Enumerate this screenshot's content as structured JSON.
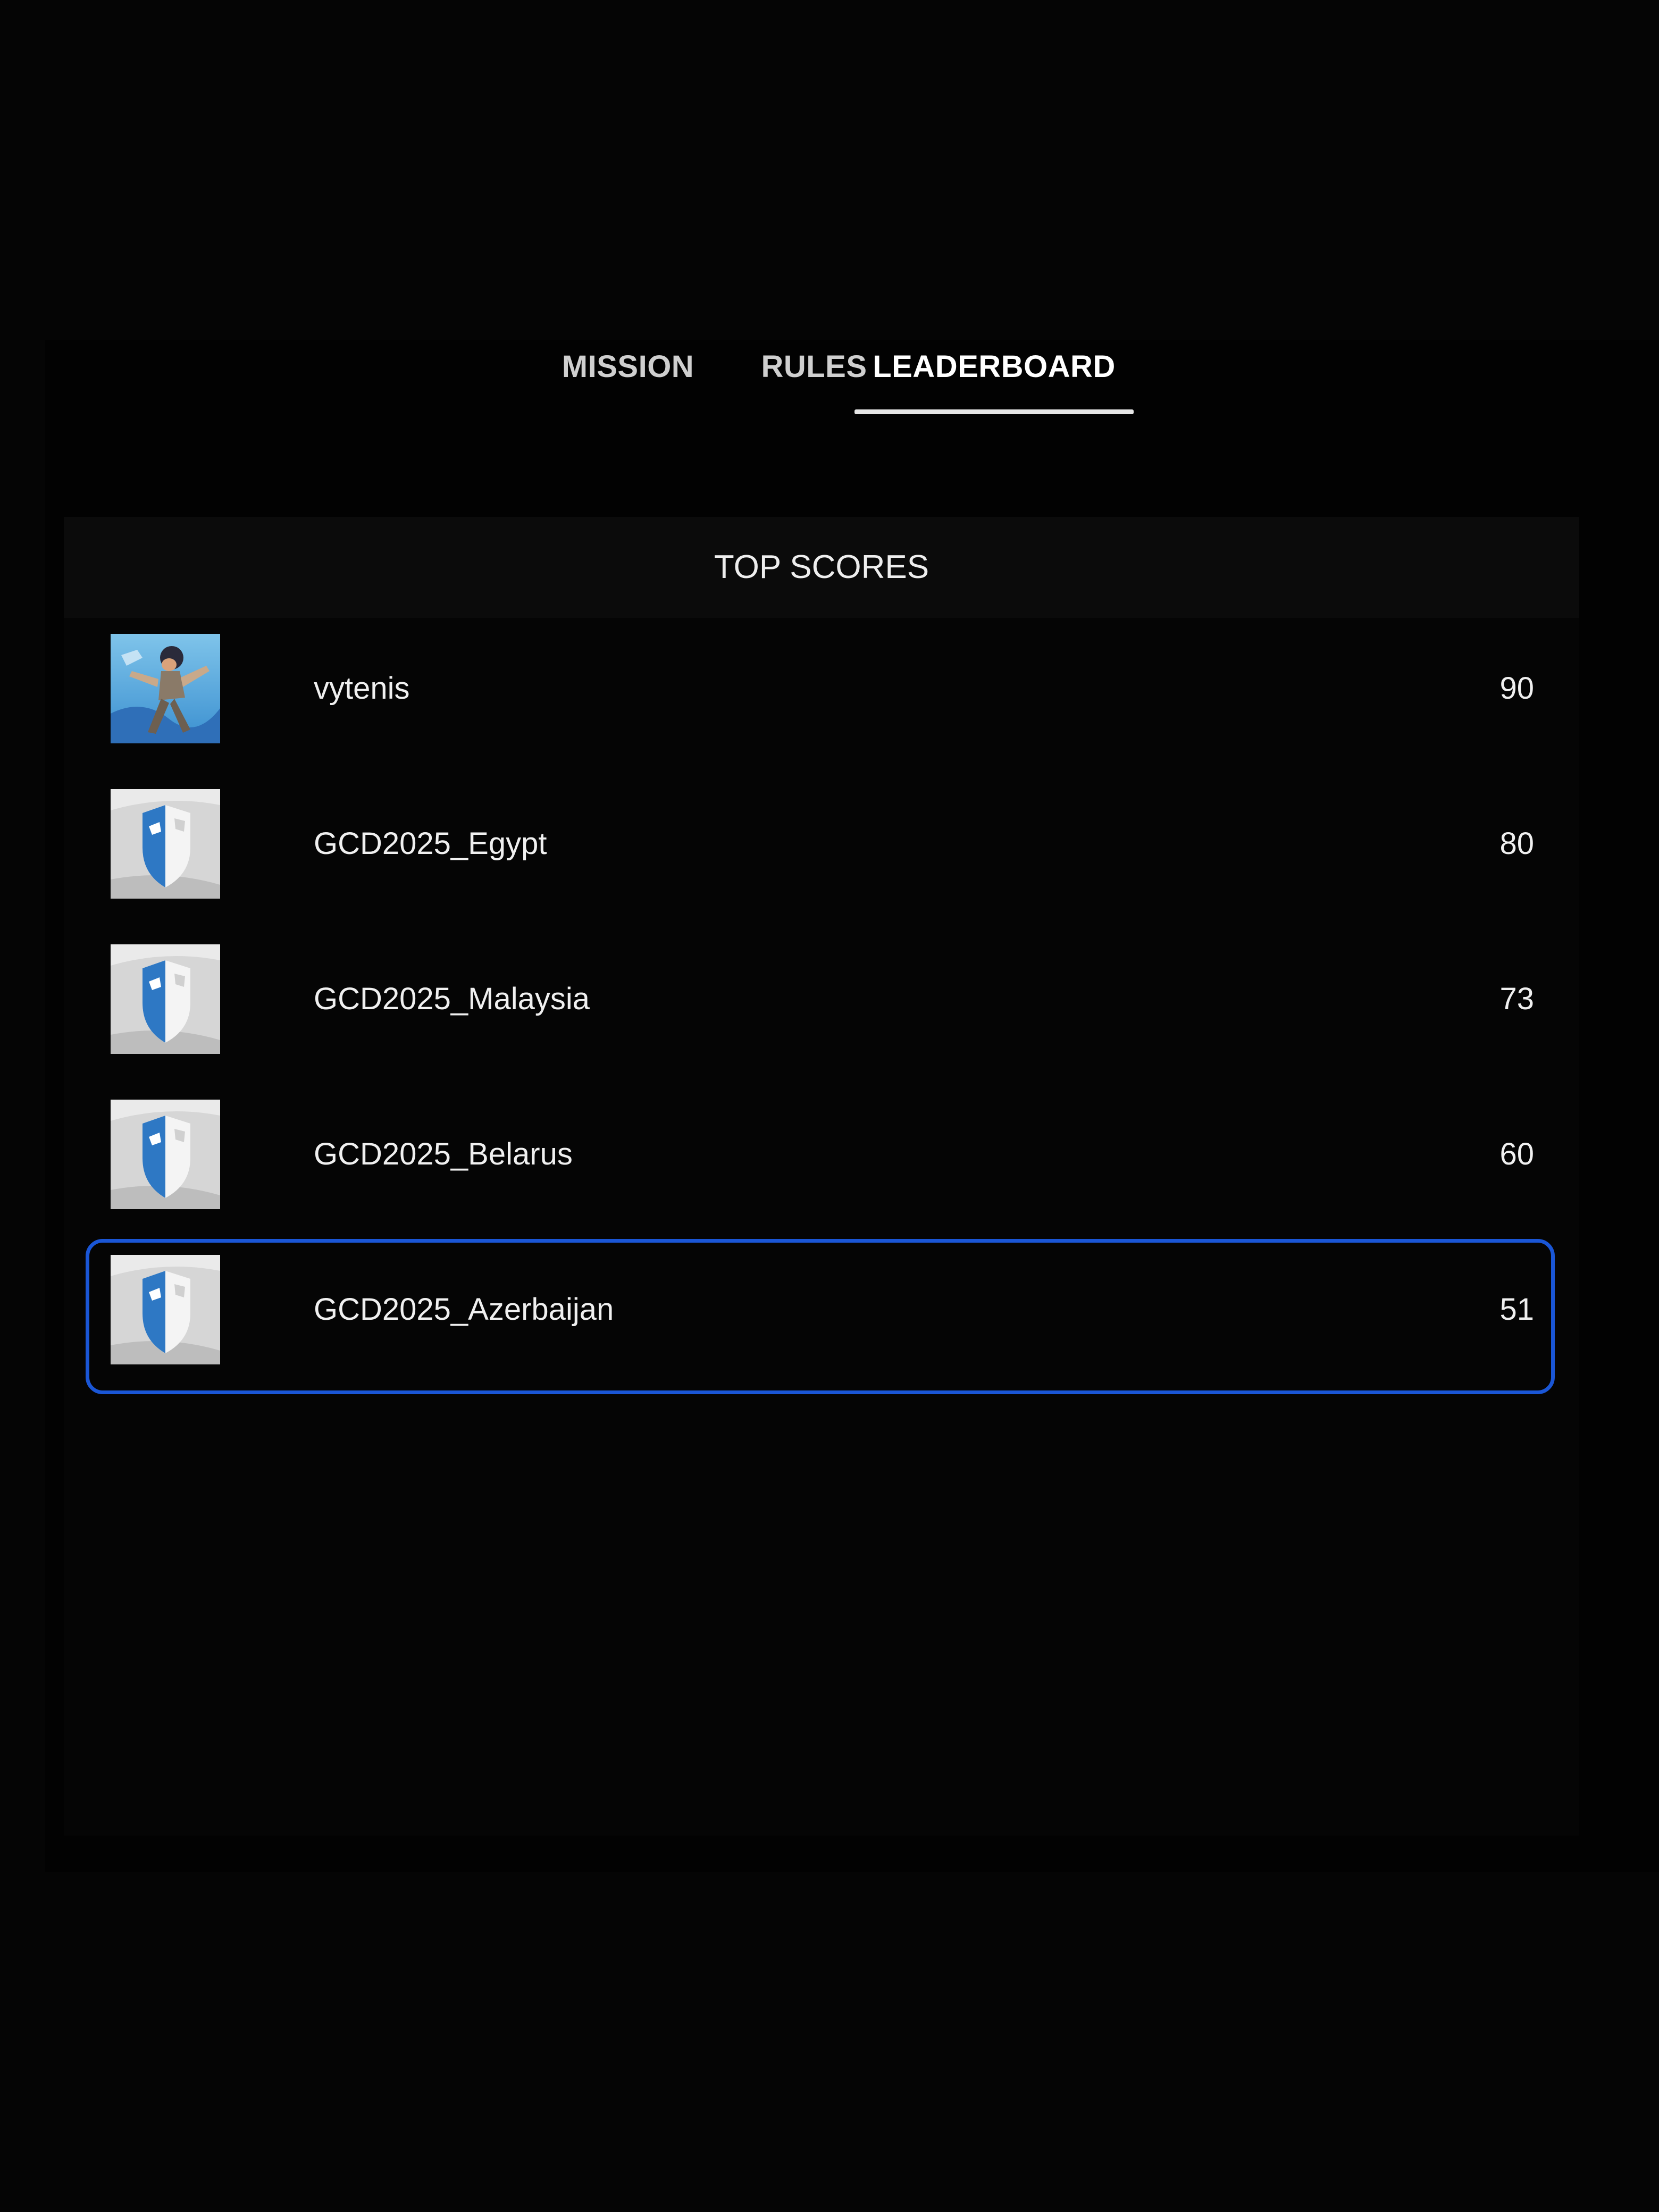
{
  "tabs": [
    {
      "label": "MISSION",
      "active": false
    },
    {
      "label": "RULES",
      "active": false
    },
    {
      "label": "LEADERBOARD",
      "active": true
    }
  ],
  "leaderboard": {
    "title": "TOP SCORES",
    "highlight_color": "#1a56d6",
    "rows": [
      {
        "name": "vytenis",
        "score": "90",
        "avatar": "character-avatar-icon"
      },
      {
        "name": "GCD2025_Egypt",
        "score": "80",
        "avatar": "shield-logo-icon"
      },
      {
        "name": "GCD2025_Malaysia",
        "score": "73",
        "avatar": "shield-logo-icon"
      },
      {
        "name": "GCD2025_Belarus",
        "score": "60",
        "avatar": "shield-logo-icon"
      },
      {
        "name": "GCD2025_Azerbaijan",
        "score": "51",
        "avatar": "shield-logo-icon",
        "highlighted": true
      }
    ]
  }
}
